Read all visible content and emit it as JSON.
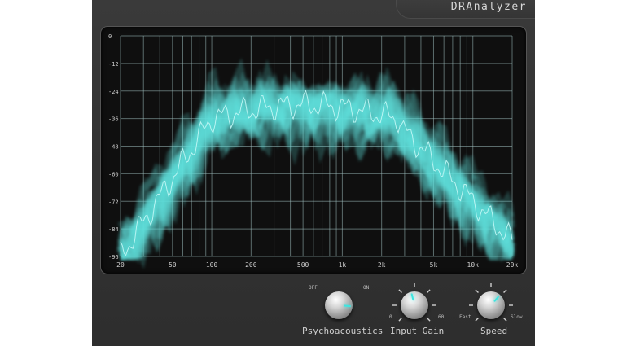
{
  "app": {
    "title": "DRAnalyzer"
  },
  "analyzer": {
    "y_labels": [
      "0",
      "-12",
      "-24",
      "-36",
      "-48",
      "-60",
      "-72",
      "-84",
      "-96"
    ],
    "x_labels": [
      "20",
      "50",
      "100",
      "200",
      "500",
      "1k",
      "2k",
      "5k",
      "10k",
      "20k"
    ],
    "ylim": [
      -96,
      0
    ],
    "xlim": [
      20,
      20000
    ],
    "x_scale": "log",
    "grid": true,
    "colors": {
      "trace": "#bff5f3",
      "glow": "#5fe0da",
      "grid": "#9ab9b9",
      "background": "#0f0f0f"
    }
  },
  "controls": {
    "psychoacoustics": {
      "label": "Psychoacoustics",
      "min_label": "OFF",
      "max_label": "ON",
      "value": 0.85
    },
    "input_gain": {
      "label": "Input Gain",
      "min_label": "0",
      "max_label": "60",
      "value": 0.45
    },
    "speed": {
      "label": "Speed",
      "min_label": "Fast",
      "max_label": "Slow",
      "value": 0.65
    }
  },
  "colors": {
    "accent": "#3ee5e0",
    "panel": "#333333"
  }
}
